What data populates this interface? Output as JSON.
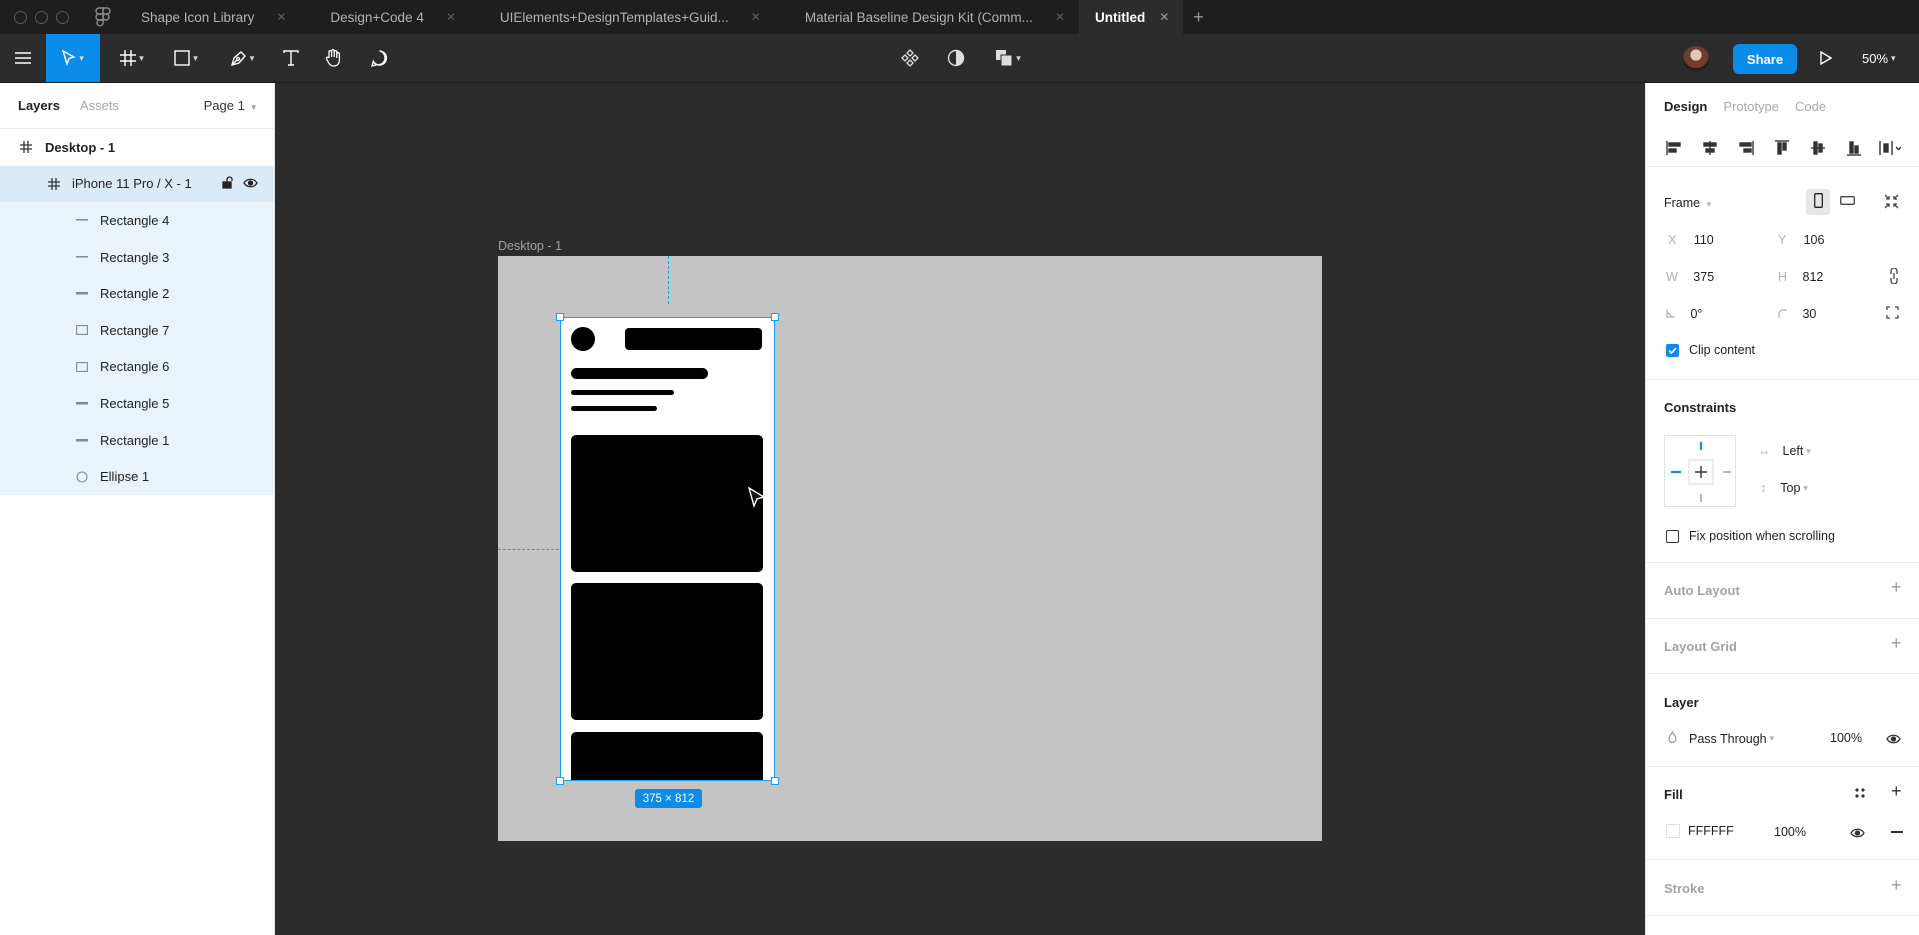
{
  "tabs": [
    {
      "label": "Shape Icon Library"
    },
    {
      "label": "Design+Code 4"
    },
    {
      "label": "UIElements+DesignTemplates+Guid..."
    },
    {
      "label": "Material Baseline Design Kit (Comm..."
    },
    {
      "label": "Untitled"
    }
  ],
  "toolbar": {
    "share_label": "Share",
    "zoom": "50%"
  },
  "left_panel": {
    "tab_layers": "Layers",
    "tab_assets": "Assets",
    "page": "Page 1",
    "layers": [
      {
        "label": "Desktop - 1",
        "type": "frame"
      },
      {
        "label": "iPhone 11 Pro / X - 1",
        "type": "frame"
      },
      {
        "label": "Rectangle 4",
        "type": "line"
      },
      {
        "label": "Rectangle 3",
        "type": "line"
      },
      {
        "label": "Rectangle 2",
        "type": "line"
      },
      {
        "label": "Rectangle 7",
        "type": "rect"
      },
      {
        "label": "Rectangle 6",
        "type": "rect"
      },
      {
        "label": "Rectangle 5",
        "type": "line"
      },
      {
        "label": "Rectangle 1",
        "type": "line"
      },
      {
        "label": "Ellipse 1",
        "type": "ellipse"
      }
    ]
  },
  "canvas": {
    "frame_label": "Desktop - 1",
    "size_badge": "375 × 812",
    "desktop_fill": "#c4c4c4",
    "selection_color": "#1a9ff0"
  },
  "right_panel": {
    "tab_design": "Design",
    "tab_prototype": "Prototype",
    "tab_code": "Code",
    "frame_label": "Frame",
    "x_label": "X",
    "x": "110",
    "y_label": "Y",
    "y": "106",
    "w_label": "W",
    "w": "375",
    "h_label": "H",
    "h": "812",
    "rotation": "0°",
    "radius": "30",
    "clip_content": "Clip content",
    "constraints_title": "Constraints",
    "constraint_h": "Left",
    "constraint_v": "Top",
    "fix_position": "Fix position when scrolling",
    "auto_layout": "Auto Layout",
    "layout_grid": "Layout Grid",
    "layer_title": "Layer",
    "blend_mode": "Pass Through",
    "layer_opacity": "100%",
    "fill_title": "Fill",
    "fill_hex": "FFFFFF",
    "fill_opacity": "100%",
    "stroke_title": "Stroke"
  },
  "colors": {
    "accent": "#0c8ce9",
    "chrome": "#2c2c2c",
    "tabbar": "#1e1e1e",
    "selected_row": "#daebf7",
    "child_row": "#e9f3fb"
  }
}
